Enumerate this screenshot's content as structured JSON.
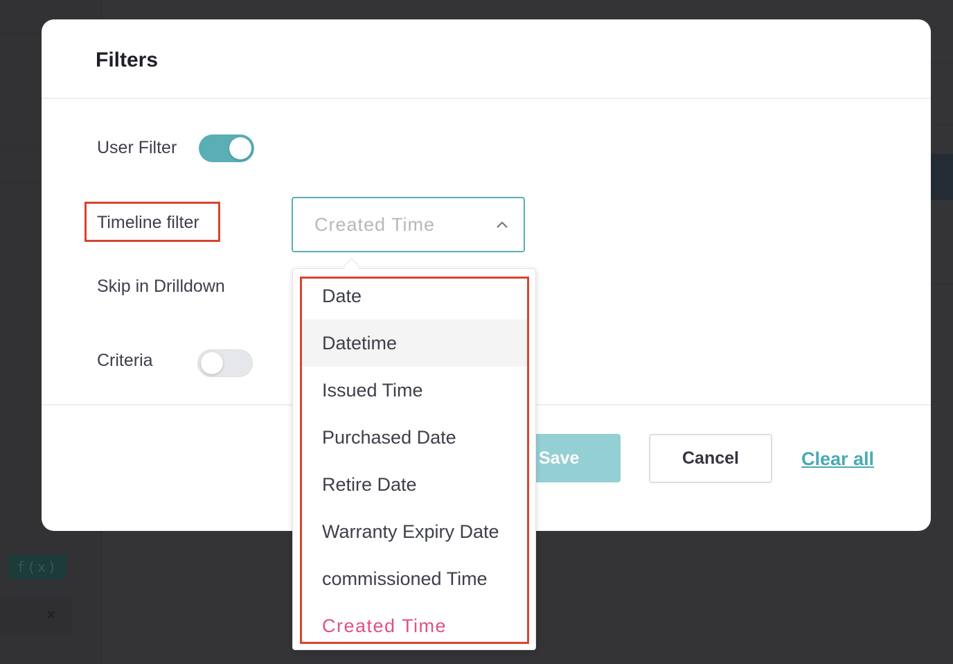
{
  "modal": {
    "title": "Filters"
  },
  "fields": {
    "user_filter_label": "User Filter",
    "user_filter_on": true,
    "timeline_filter_label": "Timeline filter",
    "skip_drilldown_label": "Skip in Drilldown",
    "criteria_label": "Criteria",
    "criteria_on": false
  },
  "timeline_select": {
    "value": "Created Time",
    "expanded": true,
    "options": [
      "Date",
      "Datetime",
      "Issued Time",
      "Purchased Date",
      "Retire Date",
      "Warranty Expiry Date",
      "commissioned Time",
      "Created Time"
    ],
    "hovered_option": "Datetime",
    "selected_option": "Created Time"
  },
  "footer": {
    "save_label": "Save",
    "cancel_label": "Cancel",
    "clear_all_label": "Clear all"
  },
  "background": {
    "fx_label": "f(x)",
    "close_glyph": "×"
  },
  "colors": {
    "accent_teal": "#5aaeb5",
    "annotation_red": "#d6452f",
    "selected_pink": "#e2507f"
  }
}
